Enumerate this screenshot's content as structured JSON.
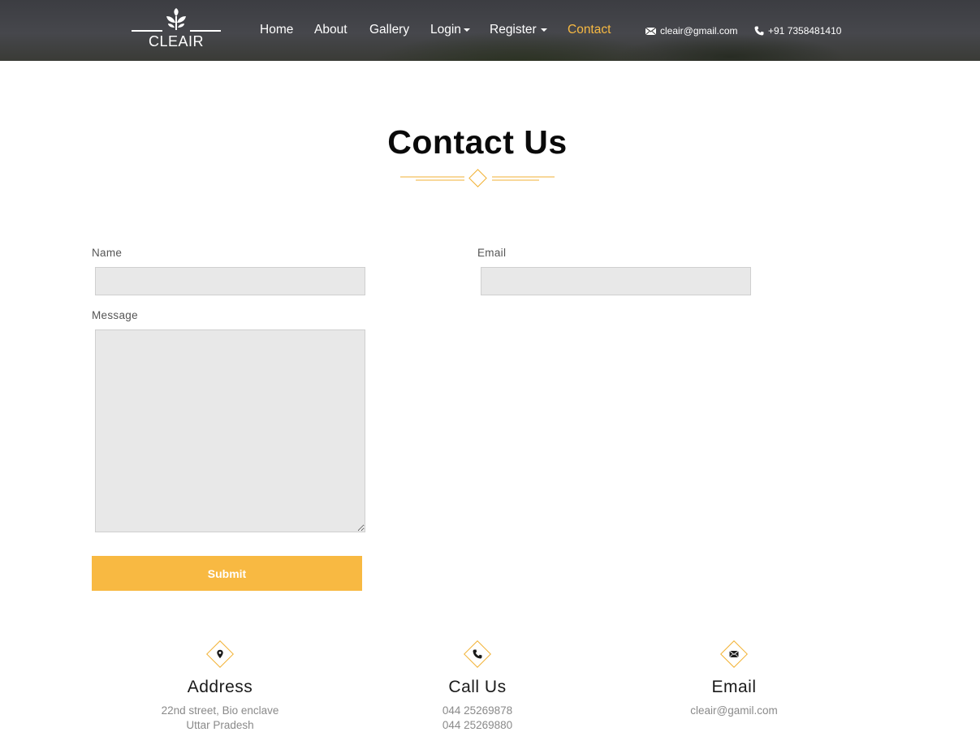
{
  "brand": {
    "logo_text": "CLEAIR"
  },
  "nav": {
    "items": [
      {
        "label": "Home"
      },
      {
        "label": "About"
      },
      {
        "label": "Gallery"
      },
      {
        "label": "Login"
      },
      {
        "label": "Register"
      },
      {
        "label": "Contact"
      }
    ],
    "active": "Contact",
    "email": "cleair@gmail.com",
    "phone": "+91 7358481410"
  },
  "page": {
    "title": "Contact Us"
  },
  "form": {
    "name_label": "Name",
    "email_label": "Email",
    "message_label": "Message",
    "name_value": "",
    "email_value": "",
    "message_value": "",
    "submit_label": "Submit"
  },
  "info": [
    {
      "icon": "map-pin-icon",
      "title": "Address",
      "lines": [
        "22nd street, Bio enclave",
        "Uttar Pradesh"
      ]
    },
    {
      "icon": "phone-icon",
      "title": "Call Us",
      "lines": [
        "044 25269878",
        "044 25269880"
      ]
    },
    {
      "icon": "envelope-icon",
      "title": "Email",
      "lines": [
        "cleair@gamil.com"
      ]
    }
  ],
  "colors": {
    "accent": "#f8b942",
    "header_bg": "#404146",
    "field_bg": "#e8e8e8"
  }
}
